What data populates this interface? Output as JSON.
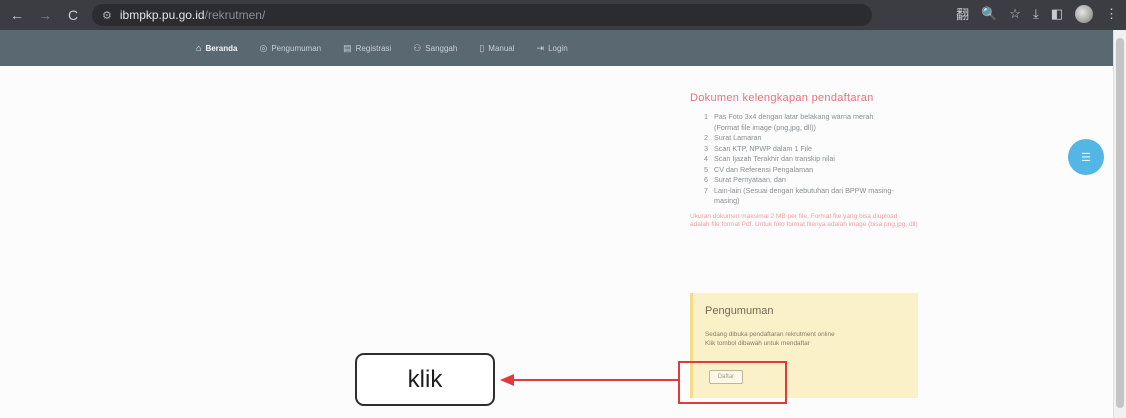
{
  "browser": {
    "back_icon": "←",
    "forward_icon": "→",
    "reload_icon": "C",
    "site_settings_icon": "⚙",
    "url_host": "ibmpkp.pu.go.id",
    "url_path": "/rekrutmen/",
    "toolbar_icons": [
      "翻",
      "🔍",
      "☆",
      "⤓",
      "◧",
      "⋮"
    ]
  },
  "nav": {
    "items": [
      {
        "icon": "⌂",
        "label": "Beranda"
      },
      {
        "icon": "◎",
        "label": "Pengumuman"
      },
      {
        "icon": "▤",
        "label": "Registrasi"
      },
      {
        "icon": "⚇",
        "label": "Sanggah"
      },
      {
        "icon": "▯",
        "label": "Manual"
      },
      {
        "icon": "⇥",
        "label": "Login"
      }
    ]
  },
  "docs": {
    "heading": "Dokumen kelengkapan pendaftaran",
    "items": [
      {
        "num": "1",
        "text": "Pas Foto 3x4 dengan latar belakang warna merah (Format file image (png,jpg, dll))"
      },
      {
        "num": "2",
        "text": "Surat Lamaran"
      },
      {
        "num": "3",
        "text": "Scan KTP, NPWP dalam 1 File"
      },
      {
        "num": "4",
        "text": "Scan Ijazah Terakhir dan transkip nilai"
      },
      {
        "num": "5",
        "text": "CV dan Referensi Pengalaman"
      },
      {
        "num": "6",
        "text": "Surat Pernyataan, dan"
      },
      {
        "num": "7",
        "text": "Lain-lain (Sesuai dengan kebutuhan dari BPPW masing-masing)"
      }
    ],
    "note": "Ukuran dokumen maksimal 2 MB per file. Format file yang bisa diupload adalah file format Pdf. Untuk foto format filenya adalah image (bisa png,jpg, dll)"
  },
  "announcement": {
    "title": "Pengumuman",
    "body_line1": "Sedang dibuka pendaftaran rekrutment online",
    "body_line2": "Klik tombol dibawah untuk mendaftar",
    "button_label": "Daftar"
  },
  "callout": {
    "label": "klik",
    "color": "#e03a3f"
  },
  "chat_icon": "☰"
}
